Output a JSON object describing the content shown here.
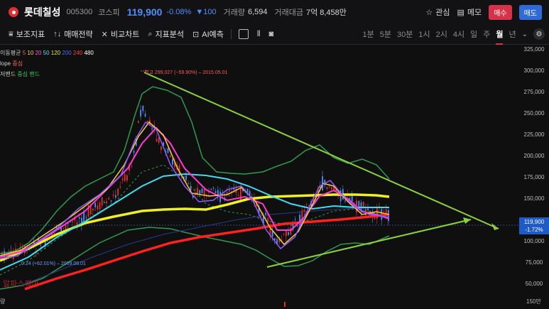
{
  "header": {
    "name": "롯데칠성",
    "code": "005300",
    "market": "코스피",
    "price": "119,900",
    "change_pct": "-0.08%",
    "change_abs": "▼100",
    "volume_label": "거래량",
    "volume": "6,594",
    "amount_label": "거래대금",
    "amount": "7억 8,458만",
    "watch_label": "관심",
    "memo_label": "메모",
    "buy_label": "매수",
    "sell_label": "매도"
  },
  "toolbar": {
    "indicators_label": "보조지표",
    "strategy_label": "매매전략",
    "compare_label": "비교차트",
    "analysis_label": "지표분석",
    "ai_label": "AI예측",
    "periods": [
      "1분",
      "5분",
      "30분",
      "1시",
      "2시",
      "4시",
      "일",
      "주",
      "월",
      "년"
    ],
    "active_period": "월"
  },
  "legend": {
    "ma_label": "이동평균",
    "ma_periods": [
      "5",
      "10",
      "20",
      "50",
      "120",
      "200",
      "240",
      "480"
    ],
    "ma_colors": [
      "#ff5a5a",
      "#ffd23a",
      "#ff5ad2",
      "#5adcff",
      "#e6e64a",
      "#4a6cff",
      "#ff4040",
      "#ffffff"
    ],
    "slope_label": "lope",
    "slope_value": "중심",
    "band_label": "저밴드",
    "band_value": "중심 밴드"
  },
  "annotations": {
    "high": "최고 299,027 (−59.90%) – 2015.05.01",
    "low": "0.24 (+62.01%) – 2009.08.01",
    "watermark": "알파스퀘어"
  },
  "yaxis": {
    "labels": [
      "325,000",
      "300,000",
      "275,000",
      "250,000",
      "225,000",
      "200,000",
      "175,000",
      "150,000",
      "125,000",
      "100,000",
      "75,000",
      "50,000"
    ],
    "current_price": "119,900",
    "current_change": "-1.72%"
  },
  "footer": {
    "left": "량",
    "right": "150만"
  },
  "colors": {
    "up": "#e03131",
    "down": "#4f8ff7",
    "accent": "#d6334a"
  }
}
